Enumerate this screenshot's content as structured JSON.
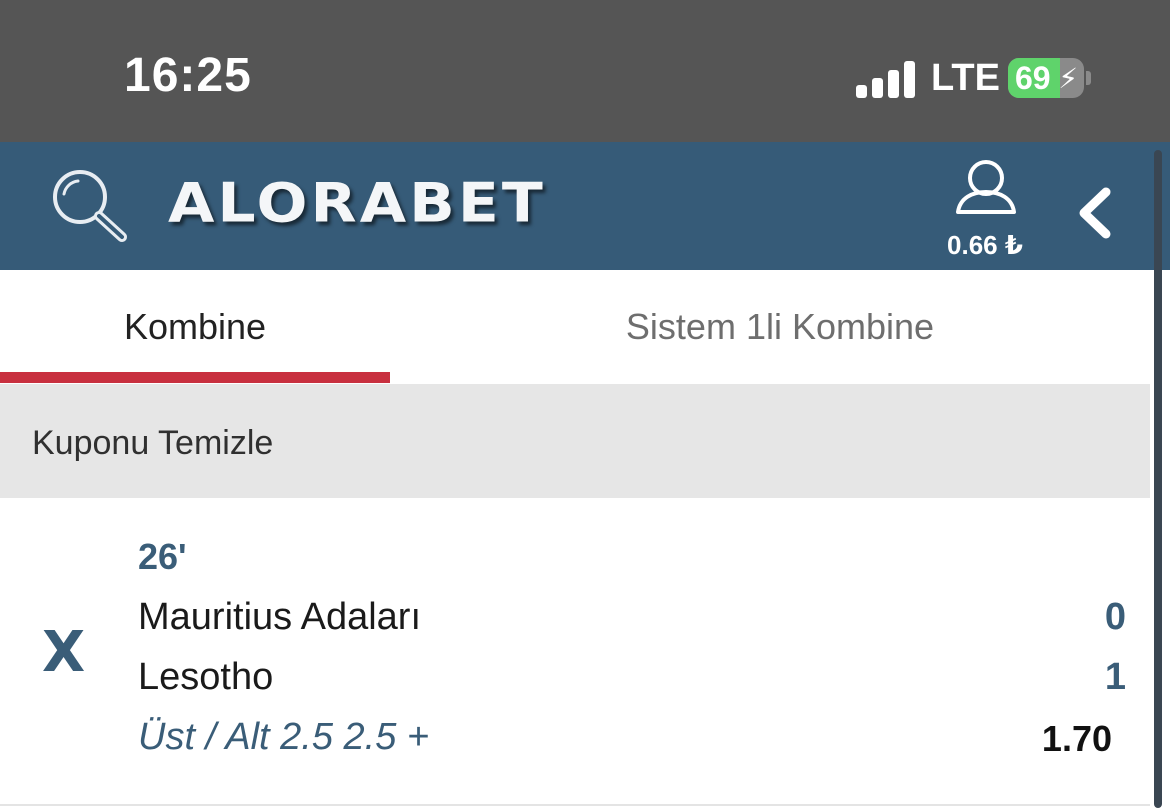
{
  "status_bar": {
    "time": "16:25",
    "network": "LTE",
    "battery_level": "69",
    "battery_fraction": 0.69
  },
  "header": {
    "logo_text": "ALORABET",
    "balance": "0.66 ₺",
    "icons": {
      "search": "search-icon",
      "user": "user-icon",
      "back": "chevron-left-icon"
    },
    "bg_color": "#365b78"
  },
  "tabs": [
    {
      "label": "Kombine",
      "active": true
    },
    {
      "label": "Sistem 1li Kombine",
      "active": false
    }
  ],
  "accent_color": "#c8303f",
  "coupon": {
    "clear_label": "Kuponu Temizle",
    "remove_symbol": "X",
    "bets": [
      {
        "minute": "26'",
        "home_team": "Mauritius Adaları",
        "away_team": "Lesotho",
        "home_score": "0",
        "away_score": "1",
        "market": "Üst / Alt 2.5 2.5 +",
        "odds": "1.70"
      }
    ]
  }
}
